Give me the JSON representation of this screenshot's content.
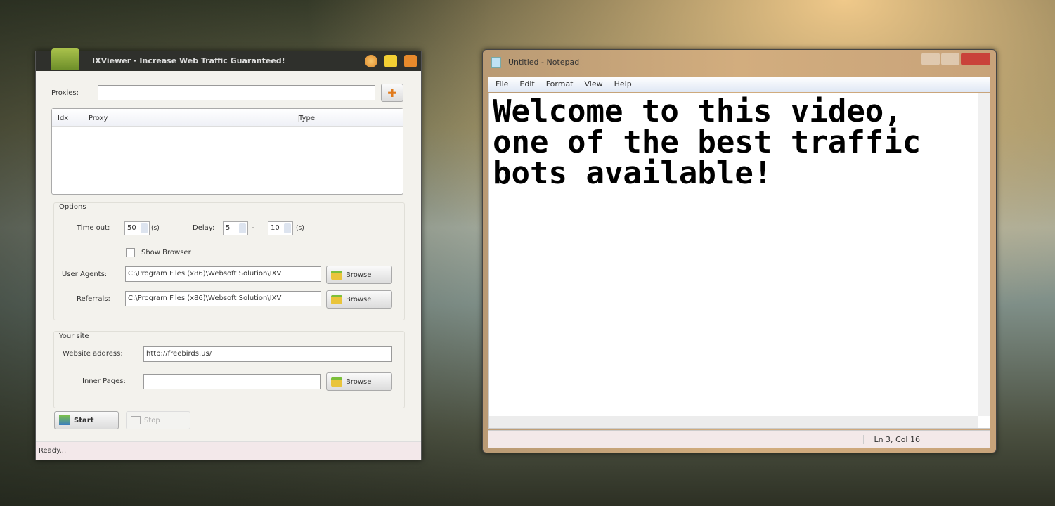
{
  "app": {
    "title": "IXViewer - Increase Web Traffic Guaranteed!",
    "proxies_label": "Proxies:",
    "proxies_value": "",
    "columns": [
      "Idx",
      "Proxy",
      "Type"
    ],
    "options_label": "Options",
    "timeout_label": "Time out:",
    "timeout_value": "50",
    "timeout_unit": "(s)",
    "delay_label": "Delay:",
    "delay_min": "5",
    "delay_sep": "-",
    "delay_max": "10",
    "delay_unit": "(s)",
    "show_browser_label": "Show Browser",
    "show_browser_checked": false,
    "user_agents_label": "User Agents:",
    "user_agents_value": "C:\\Program Files (x86)\\Websoft Solution\\IXV",
    "referrals_label": "Referrals:",
    "referrals_value": "C:\\Program Files (x86)\\Websoft Solution\\IXV",
    "browse_label": "Browse",
    "your_site_label": "Your site",
    "website_label": "Website address:",
    "website_value": "http://freebirds.us/",
    "inner_pages_label": "Inner Pages:",
    "inner_pages_value": "",
    "start_label": "Start",
    "stop_label": "Stop",
    "status": "Ready..."
  },
  "notepad": {
    "title": "Untitled - Notepad",
    "menu": [
      "File",
      "Edit",
      "Format",
      "View",
      "Help"
    ],
    "content": "Welcome to this video,\none of the best traffic\nbots available!",
    "status": "Ln 3, Col 16"
  }
}
